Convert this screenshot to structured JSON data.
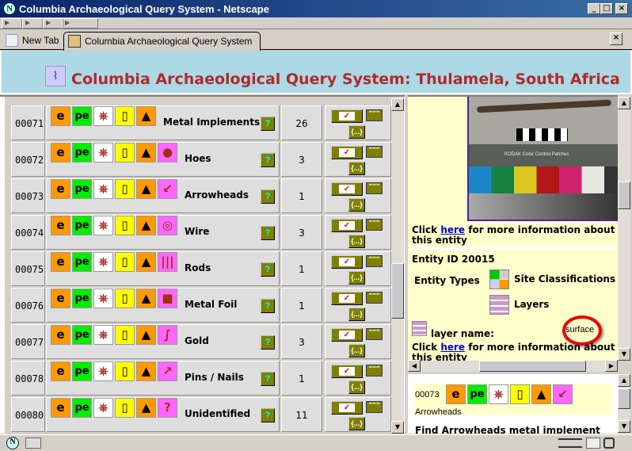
{
  "window": {
    "title": "Columbia Archaeological Query System - Netscape",
    "min": "_",
    "max": "□",
    "close": "×"
  },
  "tabs": [
    {
      "label": "New Tab"
    },
    {
      "label": "Columbia Archaeological Query System"
    }
  ],
  "tab_close": "×",
  "header": {
    "title": "Columbia Archaeological Query System: Thulamela, South Africa"
  },
  "common_icons": [
    {
      "name": "e-icon",
      "text": "e",
      "bg": "#ff9900"
    },
    {
      "name": "pe-icon",
      "text": "pe",
      "bg": "#00ee00"
    },
    {
      "name": "wheel-icon",
      "text": "⎈",
      "bg": "#ffffff"
    },
    {
      "name": "barrel-icon",
      "text": "▯",
      "bg": "#ffff00"
    },
    {
      "name": "tree-icon",
      "text": "▲",
      "bg": "#ff9900"
    }
  ],
  "rows": [
    {
      "id": "00071",
      "name": "Metal Implements",
      "count": "26",
      "icon": null
    },
    {
      "id": "00072",
      "name": "Hoes",
      "count": "3",
      "icon": {
        "name": "hoe-icon",
        "glyph": "●"
      }
    },
    {
      "id": "00073",
      "name": "Arrowheads",
      "count": "1",
      "icon": {
        "name": "arrowhead-icon",
        "glyph": "↙"
      }
    },
    {
      "id": "00074",
      "name": "Wire",
      "count": "3",
      "icon": {
        "name": "wire-coil-icon",
        "glyph": "◎"
      }
    },
    {
      "id": "00075",
      "name": "Rods",
      "count": "1",
      "icon": {
        "name": "rods-icon",
        "glyph": "|||"
      }
    },
    {
      "id": "00076",
      "name": "Metal Foil",
      "count": "1",
      "icon": {
        "name": "foil-icon",
        "glyph": "■"
      }
    },
    {
      "id": "00077",
      "name": "Gold",
      "count": "3",
      "icon": {
        "name": "gold-icon",
        "glyph": "∫"
      }
    },
    {
      "id": "00078",
      "name": "Pins / Nails",
      "count": "1",
      "icon": {
        "name": "pin-nail-icon",
        "glyph": "↗"
      }
    },
    {
      "id": "00080",
      "name": "Unidentified",
      "count": "11",
      "icon": {
        "name": "question-icon",
        "glyph": "?"
      }
    }
  ],
  "actions": {
    "check": "✓",
    "lines": "≡≡≡",
    "braces": "{...}",
    "help": "?"
  },
  "detail": {
    "photo_caption": "KODAK Color Control Patches",
    "click1_pre": "Click ",
    "click_link": "here",
    "click1_post": " for more information about this entity",
    "entity_id": "Entity ID 20015",
    "entity_types_label": "Entity Types",
    "types": [
      "Site Classifications",
      "Layers"
    ],
    "layer_name_label": "layer name:",
    "layer_name_value": "surface"
  },
  "lower": {
    "id": "00073",
    "name": "Arrowheads",
    "find": "Find Arrowheads metal implement"
  },
  "colors": {
    "accent_red": "#b02a2a",
    "header_bg": "#add8e6",
    "panel_bg": "#ffffcc",
    "action_olive": "#808000",
    "icon_pink": "#ff66ff"
  }
}
